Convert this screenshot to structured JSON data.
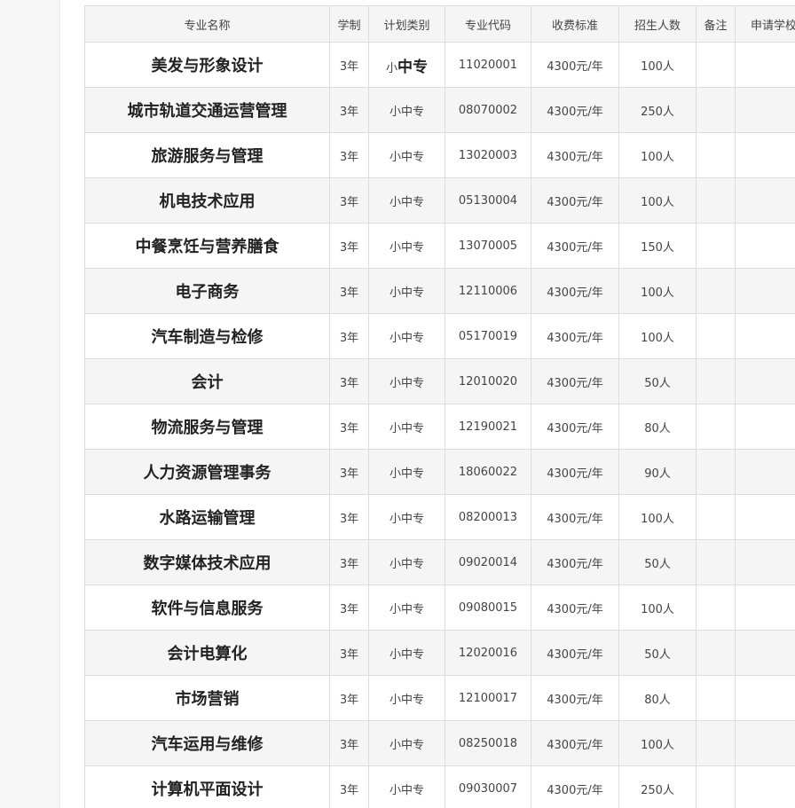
{
  "table": {
    "headers": [
      "专业名称",
      "学制",
      "计划类别",
      "专业代码",
      "收费标准",
      "招生人数",
      "备注",
      "申请学校"
    ],
    "rows": [
      {
        "name": "美发与形象设计",
        "years": "3年",
        "type_prefix": "小",
        "type_emph": "中专",
        "code": "11020001",
        "fee": "4300元/年",
        "count": "100人",
        "note": "",
        "school": ""
      },
      {
        "name": "城市轨道交通运营管理",
        "years": "3年",
        "type": "小中专",
        "code": "08070002",
        "fee": "4300元/年",
        "count": "250人",
        "note": "",
        "school": ""
      },
      {
        "name": "旅游服务与管理",
        "years": "3年",
        "type": "小中专",
        "code": "13020003",
        "fee": "4300元/年",
        "count": "100人",
        "note": "",
        "school": ""
      },
      {
        "name": "机电技术应用",
        "years": "3年",
        "type": "小中专",
        "code": "05130004",
        "fee": "4300元/年",
        "count": "100人",
        "note": "",
        "school": ""
      },
      {
        "name": "中餐烹饪与营养膳食",
        "years": "3年",
        "type": "小中专",
        "code": "13070005",
        "fee": "4300元/年",
        "count": "150人",
        "note": "",
        "school": ""
      },
      {
        "name": "电子商务",
        "years": "3年",
        "type": "小中专",
        "code": "12110006",
        "fee": "4300元/年",
        "count": "100人",
        "note": "",
        "school": ""
      },
      {
        "name": "汽车制造与检修",
        "years": "3年",
        "type": "小中专",
        "code": "05170019",
        "fee": "4300元/年",
        "count": "100人",
        "note": "",
        "school": ""
      },
      {
        "name": "会计",
        "years": "3年",
        "type": "小中专",
        "code": "12010020",
        "fee": "4300元/年",
        "count": "50人",
        "note": "",
        "school": ""
      },
      {
        "name": "物流服务与管理",
        "years": "3年",
        "type": "小中专",
        "code": "12190021",
        "fee": "4300元/年",
        "count": "80人",
        "note": "",
        "school": ""
      },
      {
        "name": "人力资源管理事务",
        "years": "3年",
        "type": "小中专",
        "code": "18060022",
        "fee": "4300元/年",
        "count": "90人",
        "note": "",
        "school": ""
      },
      {
        "name": "水路运输管理",
        "years": "3年",
        "type": "小中专",
        "code": "08200013",
        "fee": "4300元/年",
        "count": "100人",
        "note": "",
        "school": ""
      },
      {
        "name": "数字媒体技术应用",
        "years": "3年",
        "type": "小中专",
        "code": "09020014",
        "fee": "4300元/年",
        "count": "50人",
        "note": "",
        "school": ""
      },
      {
        "name": "软件与信息服务",
        "years": "3年",
        "type": "小中专",
        "code": "09080015",
        "fee": "4300元/年",
        "count": "100人",
        "note": "",
        "school": ""
      },
      {
        "name": "会计电算化",
        "years": "3年",
        "type": "小中专",
        "code": "12020016",
        "fee": "4300元/年",
        "count": "50人",
        "note": "",
        "school": ""
      },
      {
        "name": "市场营销",
        "years": "3年",
        "type": "小中专",
        "code": "12100017",
        "fee": "4300元/年",
        "count": "80人",
        "note": "",
        "school": ""
      },
      {
        "name": "汽车运用与维修",
        "years": "3年",
        "type": "小中专",
        "code": "08250018",
        "fee": "4300元/年",
        "count": "100人",
        "note": "",
        "school": ""
      },
      {
        "name": "计算机平面设计",
        "years": "3年",
        "type": "小中专",
        "code": "09030007",
        "fee": "4300元/年",
        "count": "250人",
        "note": "",
        "school": ""
      }
    ]
  }
}
